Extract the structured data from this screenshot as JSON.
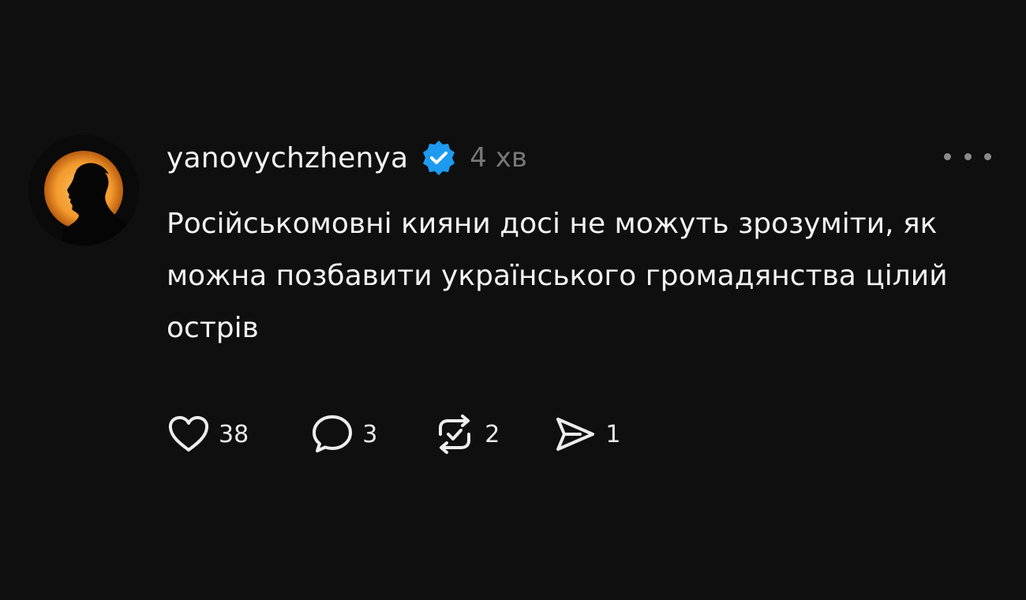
{
  "post": {
    "username": "yanovychzhenya",
    "verified_icon": "verified-badge-icon",
    "timestamp": "4 хв",
    "more_icon": "more-options-icon",
    "text": "Російськомовні кияни досі не можуть зрозуміти, як можна позбавити українського громадянства цілий острів"
  },
  "actions": {
    "like": {
      "icon": "heart-icon",
      "count": "38"
    },
    "reply": {
      "icon": "comment-icon",
      "count": "3"
    },
    "repost": {
      "icon": "repost-icon",
      "count": "2"
    },
    "share": {
      "icon": "send-icon",
      "count": "1"
    }
  },
  "colors": {
    "background": "#0f0f0f",
    "text": "#f3f3f3",
    "muted": "#777777",
    "verified": "#1d9bf0",
    "avatar_glow": "#f7a640"
  }
}
